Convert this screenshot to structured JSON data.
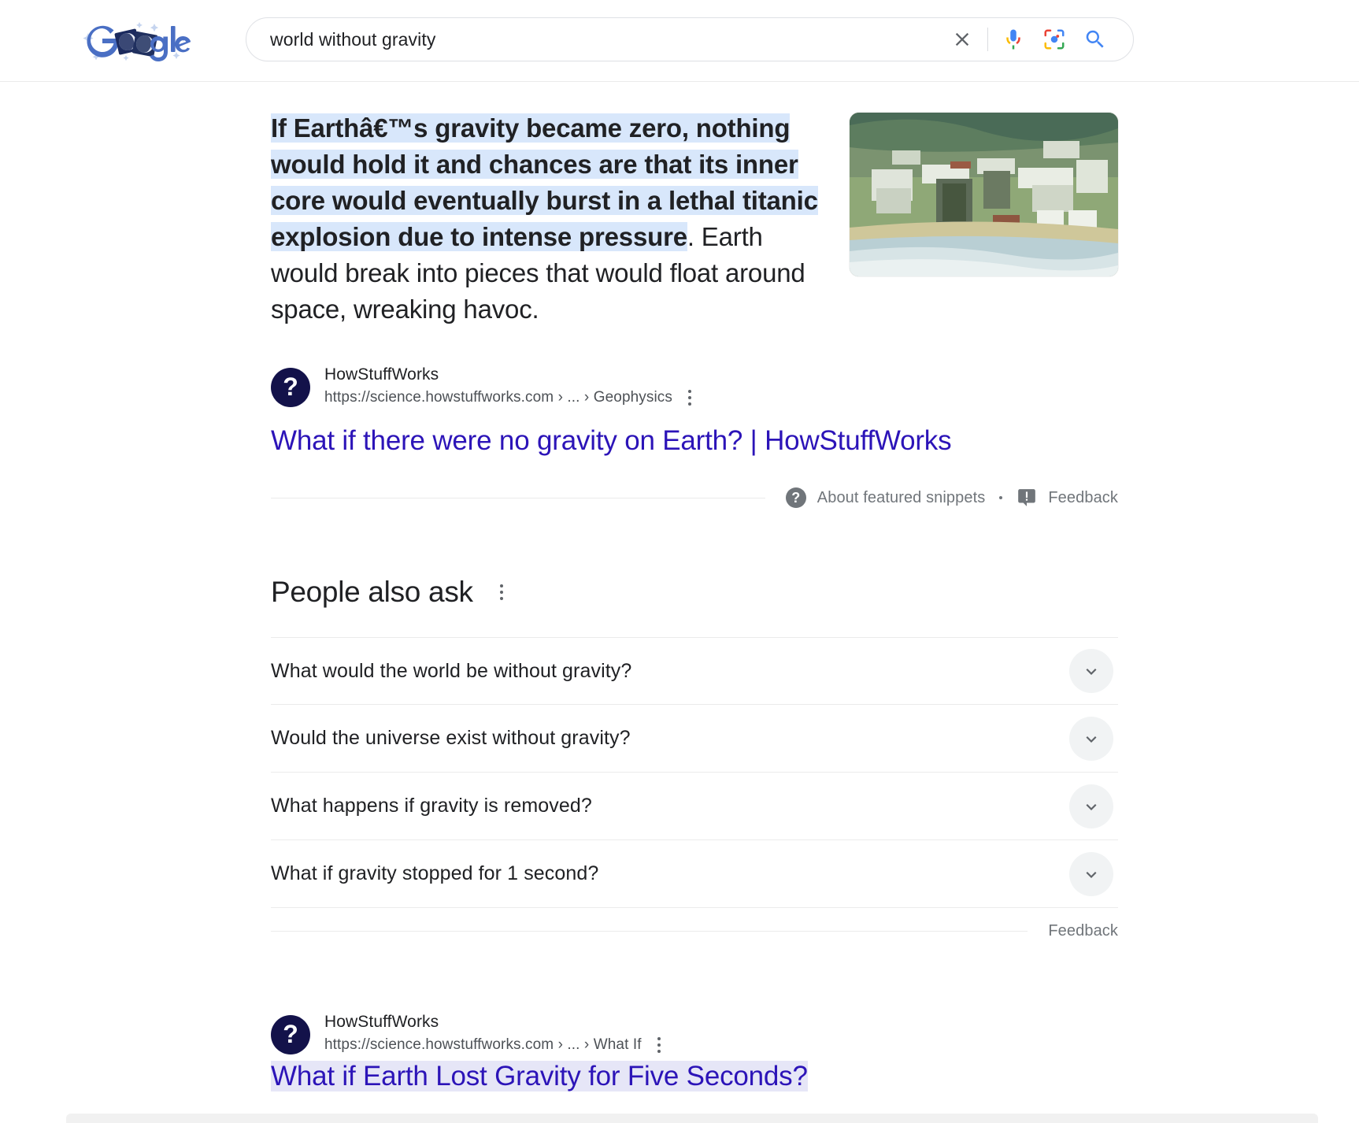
{
  "header": {
    "logo_alt": "Google doodle logo",
    "search": {
      "value": "world without gravity",
      "placeholder": "Search Google or type a URL",
      "clear_label": "Clear",
      "voice_label": "Search by voice",
      "lens_label": "Search by image",
      "submit_label": "Google Search"
    }
  },
  "featured_snippet": {
    "highlighted_text": "If Earthâ€™s gravity became zero, nothing would hold it and chances are that its inner core would eventually burst in a lethal titanic explosion due to intense pressure",
    "rest_text": ". Earth would break into pieces that would float around space, wreaking havoc.",
    "source_name": "HowStuffWorks",
    "source_url": "https://science.howstuffworks.com › ... › Geophysics",
    "favicon_glyph": "?",
    "title": "What if there were no gravity on Earth? | HowStuffWorks",
    "footer": {
      "about_label": "About featured snippets",
      "separator": "•",
      "feedback_label": "Feedback"
    }
  },
  "people_also_ask": {
    "title": "People also ask",
    "questions": [
      {
        "text": "What would the world be without gravity?"
      },
      {
        "text": "Would the universe exist without gravity?"
      },
      {
        "text": "What happens if gravity is removed?"
      },
      {
        "text": "What if gravity stopped for 1 second?"
      }
    ],
    "feedback_label": "Feedback"
  },
  "organic_result": {
    "source_name": "HowStuffWorks",
    "source_url": "https://science.howstuffworks.com › ... › What If",
    "favicon_glyph": "?",
    "title": "What if Earth Lost Gravity for Five Seconds?"
  },
  "colors": {
    "link": "#1a0dab",
    "visited_link": "#2c14b8",
    "highlight": "#d8e7fb",
    "text": "#202124",
    "muted": "#70757a",
    "url": "#4d5156",
    "divider": "#ebebeb",
    "chevron_bg": "#f1f3f4",
    "favicon_bg": "#13124a"
  }
}
